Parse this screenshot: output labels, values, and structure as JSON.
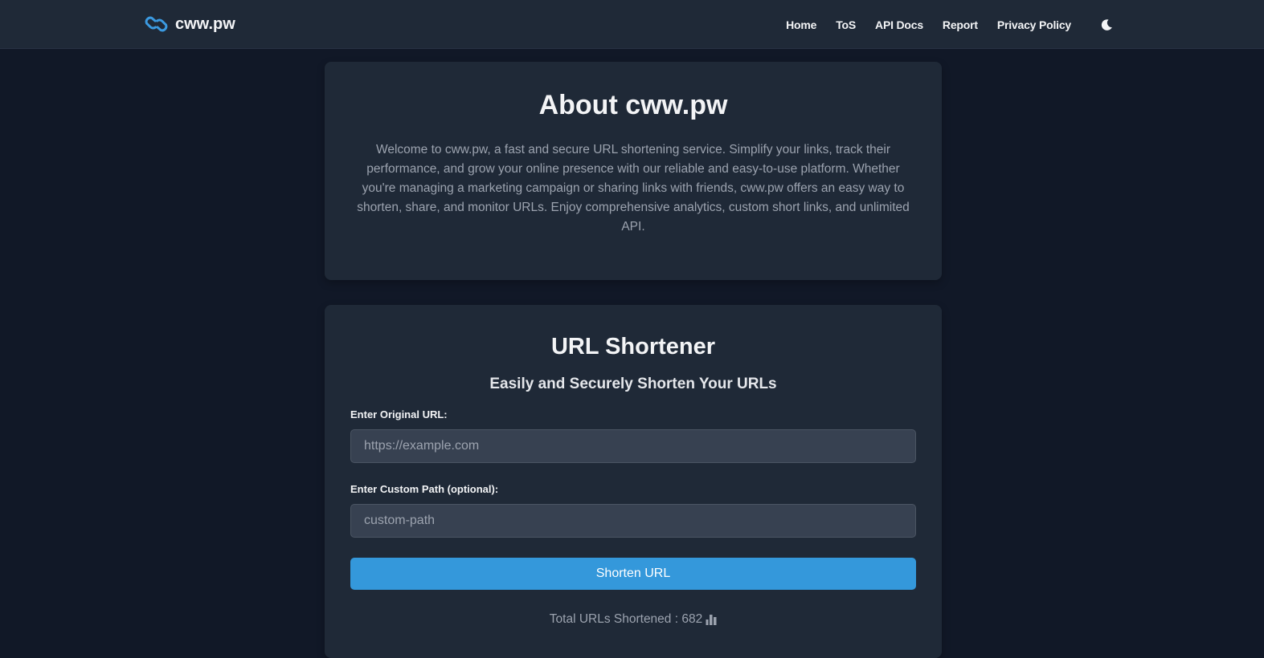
{
  "nav": {
    "brand": "cww.pw",
    "links": [
      "Home",
      "ToS",
      "API Docs",
      "Report",
      "Privacy Policy"
    ],
    "theme_icon": "moon-icon",
    "brand_icon": "link-icon"
  },
  "about": {
    "title": "About cww.pw",
    "text": "Welcome to cww.pw, a fast and secure URL shortening service. Simplify your links, track their performance, and grow your online presence with our reliable and easy-to-use platform. Whether you're managing a marketing campaign or sharing links with friends, cww.pw offers an easy way to shorten, share, and monitor URLs. Enjoy comprehensive analytics, custom short links, and unlimited API."
  },
  "shortener": {
    "title": "URL Shortener",
    "subtitle": "Easily and Securely Shorten Your URLs",
    "url_label": "Enter Original URL:",
    "url_placeholder": "https://example.com",
    "url_value": "",
    "path_label": "Enter Custom Path (optional):",
    "path_placeholder": "custom-path",
    "path_value": "",
    "button": "Shorten URL",
    "total_label": "Total URLs Shortened : 682",
    "total_icon": "bar-chart-icon"
  },
  "colors": {
    "background": "#111827",
    "card": "#1f2937",
    "accent": "#3498db",
    "input_bg": "#374151"
  }
}
